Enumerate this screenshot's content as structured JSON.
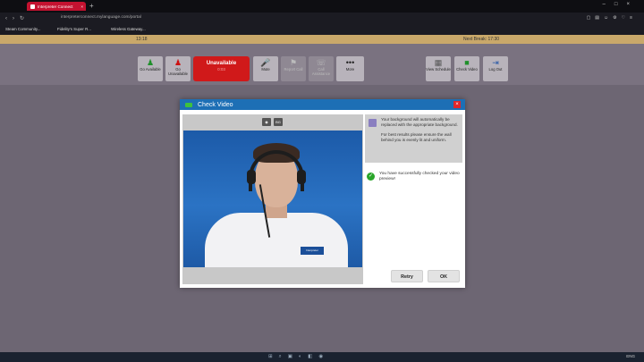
{
  "browser": {
    "tab_title": "Interpreter Connect",
    "url": "interpreterconnect.mylanguage.com/portal",
    "bookmarks": [
      "Steam Community...",
      "Fidelity's Super R...",
      "Wireless Gateway..."
    ]
  },
  "app": {
    "shift_start": "13:18",
    "shift_end": "Next Break: 17:30",
    "toolbar": [
      {
        "label": "Go Available",
        "icon": "go-available-icon"
      },
      {
        "label": "Go Unavailable",
        "icon": "go-unavailable-icon"
      },
      {
        "label": "Mute",
        "icon": "mute-icon"
      },
      {
        "label": "Report Call",
        "icon": "report-call-icon"
      },
      {
        "label": "Call Assistance",
        "icon": "call-assistance-icon"
      },
      {
        "label": "More",
        "icon": "more-icon"
      },
      {
        "label": "View Schedule",
        "icon": "view-schedule-icon"
      },
      {
        "label": "Check Video",
        "icon": "check-video-icon"
      },
      {
        "label": "Log Out",
        "icon": "log-out-icon"
      }
    ],
    "status": {
      "label": "Unavailable",
      "timer": "0:03"
    }
  },
  "dialog": {
    "title": "Check Video",
    "video_tools": [
      "camera",
      "BG"
    ],
    "info_text_1": "Your background will automatically be replaced with the appropriate background.",
    "info_text_2": "For best results please ensure the wall behind you is evenly lit and uniform.",
    "success_text": "You have successfully checked your video preview!",
    "badge_text": "Interpreter",
    "retry_label": "Retry",
    "ok_label": "OK"
  },
  "taskbar": {
    "tray_text": "ENG"
  }
}
